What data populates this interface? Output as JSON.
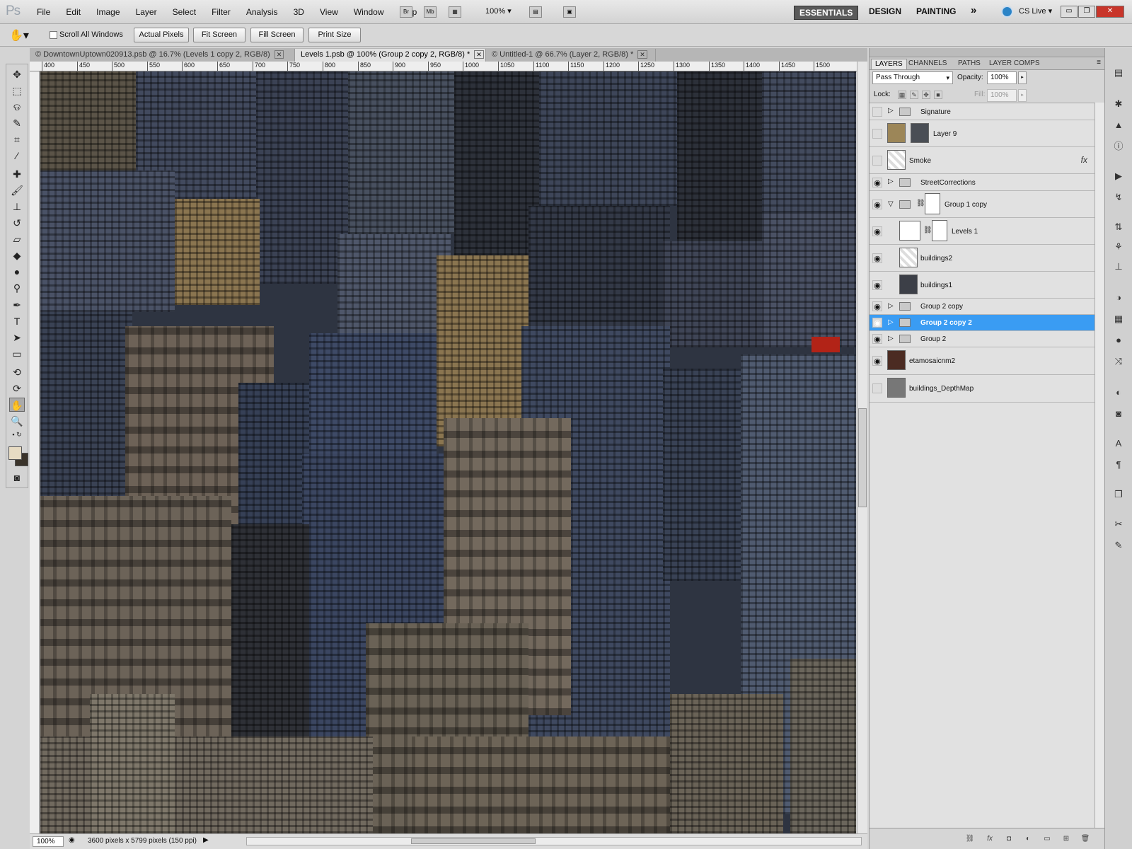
{
  "app": {
    "logo": "Ps"
  },
  "menu": [
    "File",
    "Edit",
    "Image",
    "Layer",
    "Select",
    "Filter",
    "Analysis",
    "3D",
    "View",
    "Window",
    "Help"
  ],
  "menubar_tools": {
    "br": "Br",
    "mb": "Mb",
    "zoom": "100%"
  },
  "workspaces": [
    "ESSENTIALS",
    "DESIGN",
    "PAINTING"
  ],
  "workspaces_more": "»",
  "cs_live": "CS Live",
  "window_buttons": {
    "minimize": "▭",
    "restore": "❐",
    "close": "✕"
  },
  "options": {
    "scroll_all": "Scroll All Windows",
    "buttons": [
      "Actual Pixels",
      "Fit Screen",
      "Fill Screen",
      "Print Size"
    ]
  },
  "tabs": [
    {
      "label": "© DowntownUptown020913.psb @ 16.7% (Levels 1 copy 2, RGB/8)",
      "active": false
    },
    {
      "label": "Levels 1.psb @ 100% (Group 2 copy 2, RGB/8) *",
      "active": true
    },
    {
      "label": "© Untitled-1 @ 66.7% (Layer 2, RGB/8) *",
      "active": false
    }
  ],
  "tab_close": "✕",
  "tools": [
    "move-icon",
    "marquee-icon",
    "lasso-icon",
    "quick-select-icon",
    "crop-icon",
    "eyedropper-icon",
    "healing-brush-icon",
    "brush-icon",
    "stamp-icon",
    "history-brush-icon",
    "eraser-icon",
    "paint-bucket-icon",
    "dodge-icon",
    "pen-icon",
    "type-icon",
    "path-select-icon",
    "rectangle-icon",
    "3d-rotate-icon",
    "3d-orbit-icon",
    "hand-icon",
    "zoom-icon"
  ],
  "colors": {
    "foreground": "#e7dbc3",
    "background": "#3a332a",
    "selection": "#3a9cf3",
    "canvas_sky": "#2e3441"
  },
  "ruler": [
    "400",
    "450",
    "500",
    "550",
    "600",
    "650",
    "700",
    "750",
    "800",
    "850",
    "900",
    "950",
    "1000",
    "1050",
    "1100",
    "1150",
    "1200",
    "1250",
    "1300",
    "1350",
    "1400",
    "1450",
    "1500"
  ],
  "status": {
    "zoom": "100%",
    "info": "3600 pixels x 5799 pixels (150 ppi)"
  },
  "panel": {
    "tabs": [
      "LAYERS",
      "CHANNELS",
      "PATHS",
      "LAYER COMPS"
    ],
    "blend_mode": "Pass Through",
    "opacity_label": "Opacity:",
    "opacity": "100%",
    "lock_label": "Lock:",
    "fill_label": "Fill:",
    "fill": "100%"
  },
  "layers": [
    {
      "name": "Signature",
      "type": "group",
      "visible": false,
      "expanded": false
    },
    {
      "name": "Layer 9",
      "type": "image",
      "visible": false
    },
    {
      "name": "Smoke",
      "type": "image",
      "visible": false,
      "fx": "fx"
    },
    {
      "name": "StreetCorrections",
      "type": "group",
      "visible": true,
      "expanded": false
    },
    {
      "name": "Group 1 copy",
      "type": "group",
      "visible": true,
      "expanded": true
    },
    {
      "name": "Levels 1",
      "type": "adjustment",
      "visible": true
    },
    {
      "name": "buildings2",
      "type": "smart",
      "visible": true
    },
    {
      "name": "buildings1",
      "type": "smart",
      "visible": true
    },
    {
      "name": "Group 2 copy",
      "type": "group",
      "visible": true,
      "expanded": false
    },
    {
      "name": "Group 2 copy 2",
      "type": "group",
      "visible": true,
      "expanded": false,
      "selected": true
    },
    {
      "name": "Group 2",
      "type": "group",
      "visible": true,
      "expanded": false
    },
    {
      "name": "etamosaicnm2",
      "type": "smart",
      "visible": true
    },
    {
      "name": "buildings_DepthMap",
      "type": "smart",
      "visible": false
    }
  ]
}
